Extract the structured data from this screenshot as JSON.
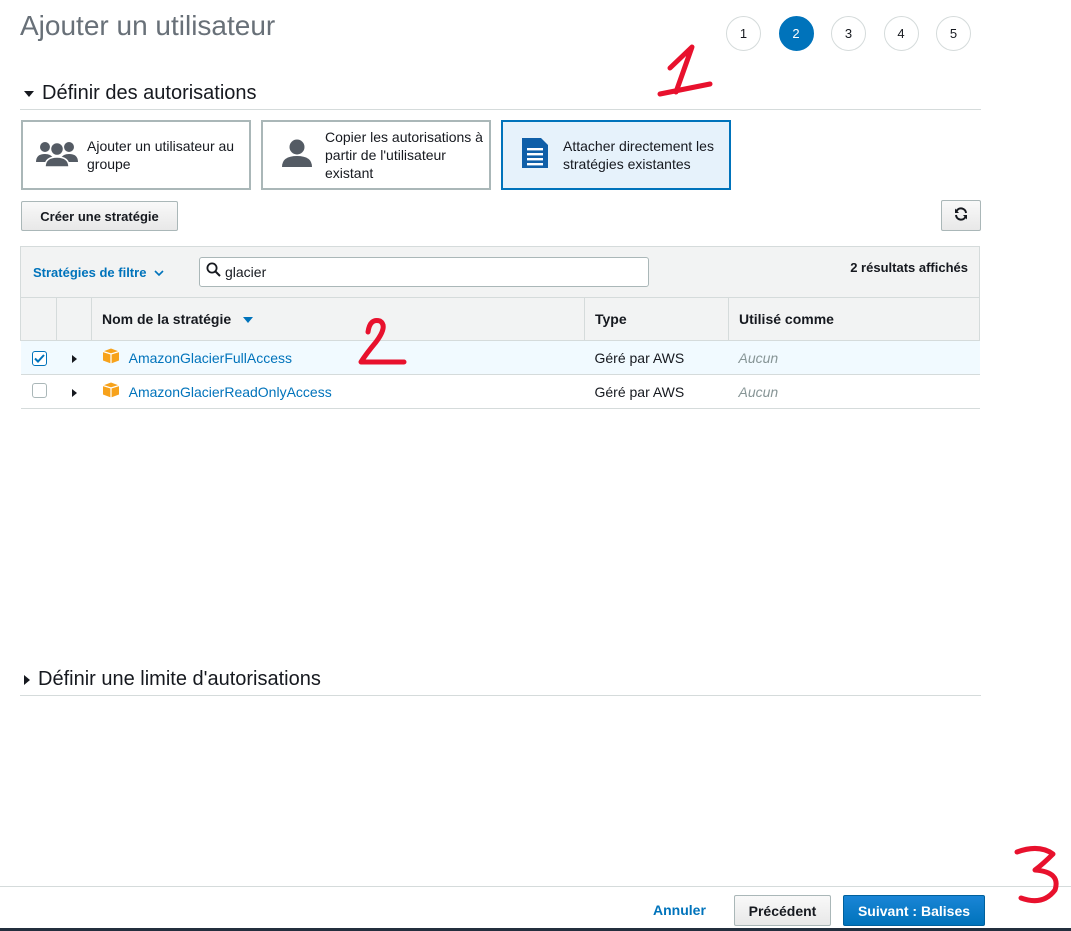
{
  "page": {
    "title": "Ajouter un utilisateur"
  },
  "steps": [
    "1",
    "2",
    "3",
    "4",
    "5"
  ],
  "active_step": "2",
  "section_permissions": {
    "title": "Définir des autorisations"
  },
  "options": {
    "group": "Ajouter un utilisateur au groupe",
    "copy": "Copier les autorisations à partir de l'utilisateur existant",
    "attach": "Attacher directement les stratégies existantes"
  },
  "create_policy_label": "Créer une stratégie",
  "filter": {
    "label": "Stratégies de filtre",
    "search_value": "glacier",
    "results": "2 résultats affichés"
  },
  "table": {
    "headers": {
      "name": "Nom de la stratégie",
      "type": "Type",
      "used_as": "Utilisé comme"
    },
    "rows": [
      {
        "name": "AmazonGlacierFullAccess",
        "type": "Géré par AWS",
        "used_as": "Aucun",
        "checked": true
      },
      {
        "name": "AmazonGlacierReadOnlyAccess",
        "type": "Géré par AWS",
        "used_as": "Aucun",
        "checked": false
      }
    ]
  },
  "section_boundary": {
    "title": "Définir une limite d'autorisations"
  },
  "footer": {
    "cancel": "Annuler",
    "previous": "Précédent",
    "next": "Suivant : Balises"
  },
  "colors": {
    "accent": "#0073bb",
    "annotation": "#e8112d",
    "policy_icon": "#f7a21b"
  }
}
